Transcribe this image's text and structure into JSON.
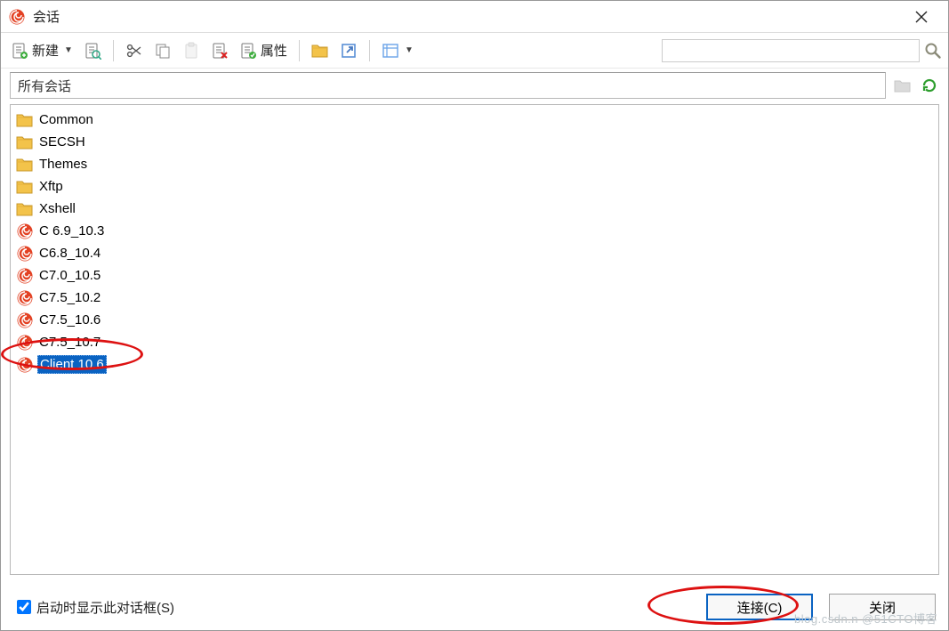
{
  "window": {
    "title": "会话"
  },
  "toolbar": {
    "new_label": "新建",
    "props_label": "属性"
  },
  "path": {
    "current": "所有会话"
  },
  "items": [
    {
      "name": "Common",
      "kind": "folder",
      "selected": false
    },
    {
      "name": "SECSH",
      "kind": "folder",
      "selected": false
    },
    {
      "name": "Themes",
      "kind": "folder",
      "selected": false
    },
    {
      "name": "Xftp",
      "kind": "folder",
      "selected": false
    },
    {
      "name": "Xshell",
      "kind": "folder",
      "selected": false
    },
    {
      "name": "C 6.9_10.3",
      "kind": "session",
      "selected": false
    },
    {
      "name": "C6.8_10.4",
      "kind": "session",
      "selected": false
    },
    {
      "name": "C7.0_10.5",
      "kind": "session",
      "selected": false
    },
    {
      "name": "C7.5_10.2",
      "kind": "session",
      "selected": false
    },
    {
      "name": "C7.5_10.6",
      "kind": "session",
      "selected": false
    },
    {
      "name": "C7.5_10.7",
      "kind": "session",
      "selected": false
    },
    {
      "name": "Client 10.6",
      "kind": "session",
      "selected": true
    }
  ],
  "footer": {
    "checkbox_label": "启动时显示此对话框(S)",
    "checkbox_checked": true,
    "connect_label": "连接(C)",
    "close_label": "关闭"
  },
  "watermark": "blog.csdn.n @51CTO博客"
}
